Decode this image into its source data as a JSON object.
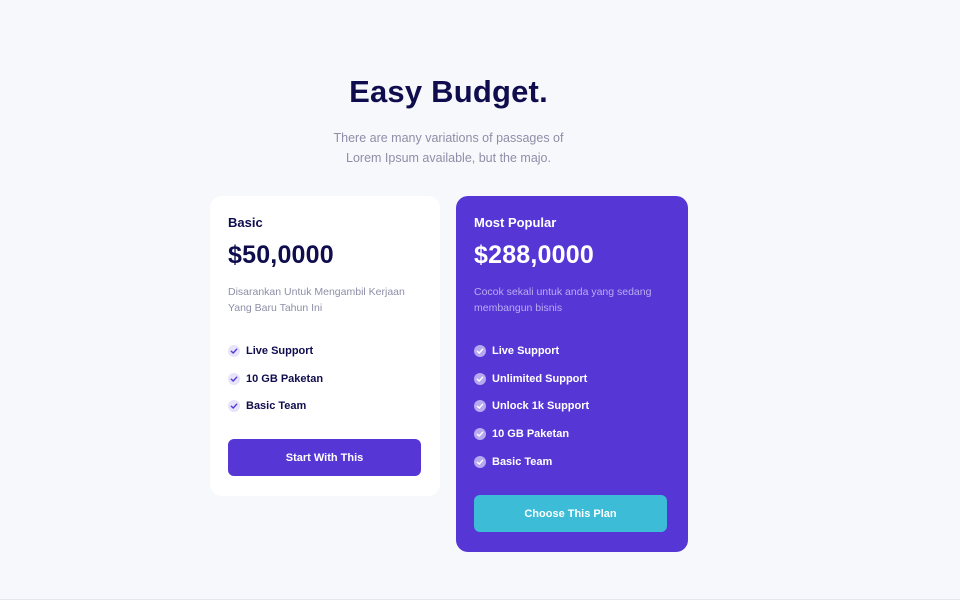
{
  "header": {
    "title": "Easy Budget.",
    "subtitle_line1": "There are many variations of passages of",
    "subtitle_line2": "Lorem Ipsum available, but the majo."
  },
  "plans": [
    {
      "name": "Basic",
      "price": "$50,0000",
      "description": "Disarankan Untuk Mengambil Kerjaan Yang Baru Tahun Ini",
      "features": [
        "Live Support",
        "10 GB Paketan",
        "Basic Team"
      ],
      "cta_label": "Start With This"
    },
    {
      "name": "Most Popular",
      "price": "$288,0000",
      "description": "Cocok sekali untuk anda yang sedang membangun bisnis",
      "features": [
        "Live Support",
        "Unlimited Support",
        "Unlock 1k Support",
        "10 GB Paketan",
        "Basic Team"
      ],
      "cta_label": "Choose This Plan"
    }
  ],
  "icons": {
    "feature_bullet": "check-circle-icon"
  },
  "colors": {
    "brand_purple": "#5637d6",
    "heading_navy": "#0f0d4d",
    "cta_cyan": "#3cbcd6",
    "background": "#f7f8fb"
  }
}
